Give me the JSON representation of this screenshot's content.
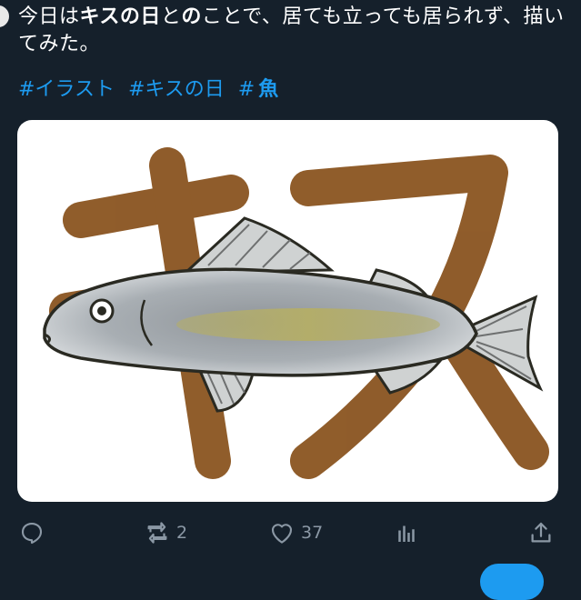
{
  "tweet": {
    "text_parts": [
      {
        "text": "今日は",
        "bold": false
      },
      {
        "text": "キスの日",
        "bold": true
      },
      {
        "text": "と",
        "bold": false
      },
      {
        "text": "の",
        "bold": true
      },
      {
        "text": "ことで、居ても立っても居られず、描いてみた。",
        "bold": false
      }
    ],
    "hashtags": [
      {
        "plain": "#イラスト",
        "bold": ""
      },
      {
        "plain": "#キスの日",
        "bold": ""
      },
      {
        "plain": "#",
        "bold": "魚"
      }
    ]
  },
  "media": {
    "description_icon": "fish-illustration",
    "colors": {
      "background": "#ffffff",
      "katakana_stroke": "#8a5420",
      "fish_body": "#a8aeb3",
      "fish_stripe": "#b3ad6a",
      "outline": "#2a2a22"
    }
  },
  "actions": {
    "reply": {
      "icon": "reply-icon",
      "count": ""
    },
    "retweet": {
      "icon": "retweet-icon",
      "count": "2"
    },
    "like": {
      "icon": "heart-icon",
      "count": "37"
    },
    "views": {
      "icon": "analytics-icon",
      "count": ""
    },
    "share": {
      "icon": "share-icon",
      "count": ""
    }
  },
  "colors": {
    "background": "#15202b",
    "text": "#ffffff",
    "link": "#1d9bf0",
    "muted": "#8b98a5"
  }
}
